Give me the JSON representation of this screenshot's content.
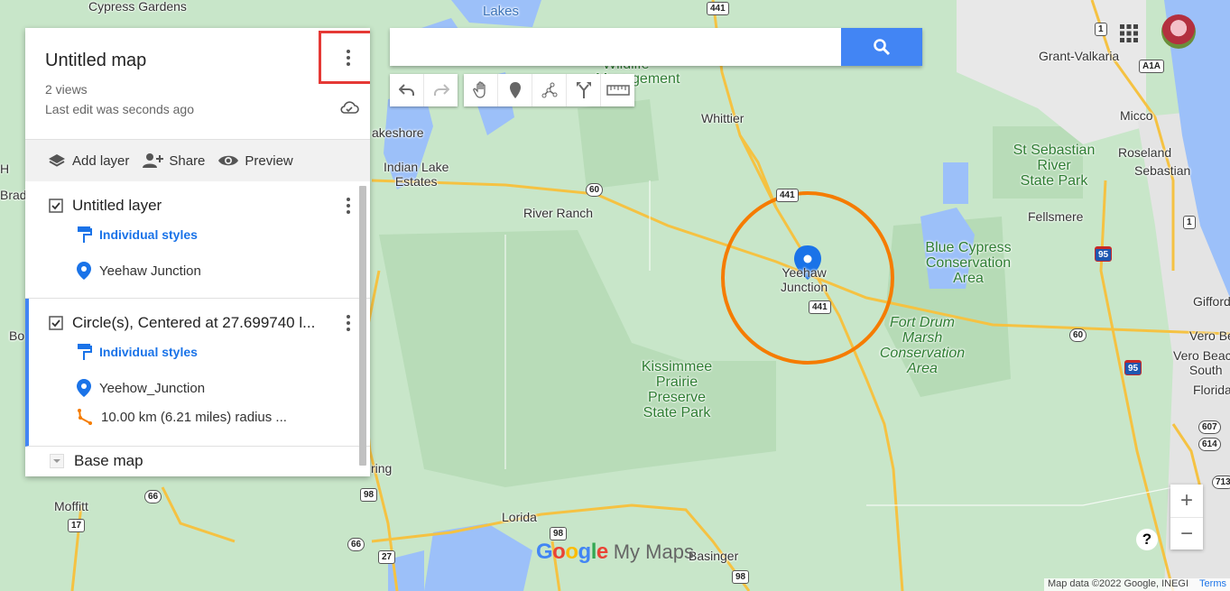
{
  "map": {
    "labels": {
      "cypress_gardens": "Cypress\nGardens",
      "lakes": "Lakes",
      "lakeshore": "akeshore",
      "indian_lake": "Indian Lake\nEstates",
      "river_ranch": "River Ranch",
      "whittier": "Whittier",
      "wildlife": "Wildlife",
      "management": "Management",
      "yeehaw": "Yeehaw\nJunction",
      "kissimmee": "Kissimmee\nPrairie\nPreserve\nState Park",
      "fort_drum": "Fort Drum\nMarsh\nConservation\nArea",
      "blue_cypress": "Blue Cypress\nConservation\nArea",
      "st_sebastian": "St Sebastian\nRiver\nState Park",
      "fellsmere": "Fellsmere",
      "grant_valkaria": "Grant-Valkaria",
      "micco": "Micco",
      "roseland": "Roseland",
      "sebastian": "Sebastian",
      "gifford": "Gifford",
      "vero_beach": "Vero Be",
      "vero_beach_south": "Vero Beach\nSouth",
      "florida": "Florida",
      "moffitt": "Moffitt",
      "lorida": "Lorida",
      "basinger": "Basinger",
      "ring": "ring",
      "h": "H",
      "brad": "Brad",
      "bo": "Bo"
    },
    "shields": [
      "441",
      "60",
      "441",
      "441",
      "60",
      "60",
      "1",
      "1",
      "A1A",
      "95",
      "95",
      "66",
      "17",
      "98",
      "66",
      "27",
      "98",
      "98",
      "607",
      "614",
      "713"
    ]
  },
  "panel": {
    "title": "Untitled map",
    "views": "2 views",
    "last_edit": "Last edit was seconds ago",
    "actions": {
      "add_layer": "Add layer",
      "share": "Share",
      "preview": "Preview"
    },
    "layers": [
      {
        "name": "Untitled layer",
        "style": "Individual styles",
        "items": [
          {
            "label": "Yeehaw Junction",
            "icon": "place-marker-icon"
          }
        ]
      },
      {
        "name": "Circle(s), Centered at 27.699740 l...",
        "style": "Individual styles",
        "items": [
          {
            "label": "Yeehow_Junction",
            "icon": "place-marker-icon"
          },
          {
            "label": "10.00 km (6.21 miles) radius ...",
            "icon": "line-icon"
          }
        ]
      }
    ],
    "base_map": "Base map"
  },
  "search": {
    "placeholder": ""
  },
  "logo": {
    "google": "Google",
    "product": "My Maps"
  },
  "attribution": {
    "data": "Map data ©2022 Google, INEGI",
    "terms": "Terms"
  },
  "zoom": {
    "in": "+",
    "out": "−"
  },
  "help": "?",
  "colors": {
    "accent": "#4285f4",
    "highlight_box": "#e53935",
    "circle": "#f57c00",
    "marker": "#1a73e8"
  }
}
